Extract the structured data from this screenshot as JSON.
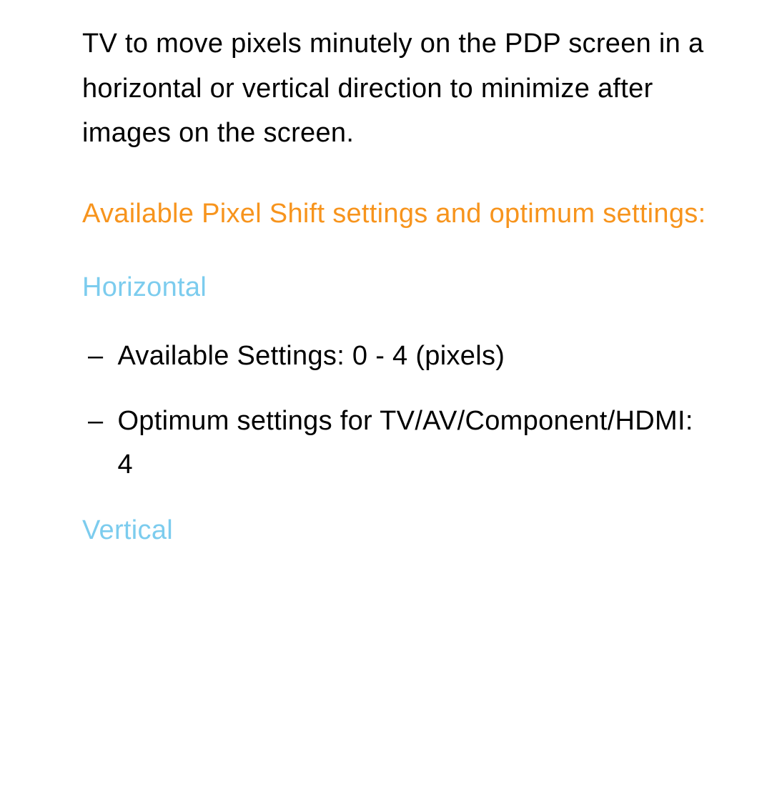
{
  "intro_paragraph": "TV to move pixels minutely on the PDP screen in a horizontal or vertical direction to minimize after images on the screen.",
  "section_heading": "Available Pixel Shift settings and optimum settings:",
  "horizontal": {
    "label": "Horizontal",
    "items": [
      "Available Settings: 0 - 4 (pixels)",
      "Optimum settings for TV/AV/Component/HDMI: 4"
    ]
  },
  "vertical": {
    "label": "Vertical"
  },
  "dash": "–"
}
